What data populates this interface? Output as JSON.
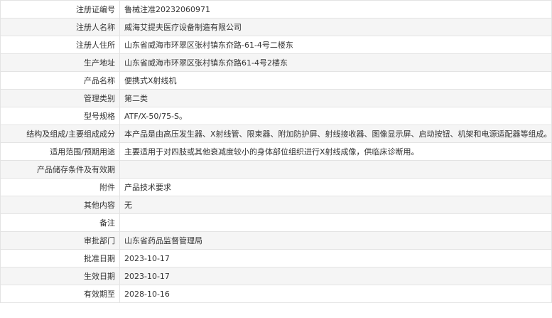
{
  "rows": [
    {
      "label": "注册证编号",
      "value": "鲁械注准20232060971"
    },
    {
      "label": "注册人名称",
      "value": "威海艾提夫医疗设备制造有限公司"
    },
    {
      "label": "注册人住所",
      "value": "山东省威海市环翠区张村镇东夼路-61-4号二楼东"
    },
    {
      "label": "生产地址",
      "value": "山东省威海市环翠区张村镇东夼路61-4号2楼东"
    },
    {
      "label": "产品名称",
      "value": "便携式X射线机"
    },
    {
      "label": "管理类别",
      "value": "第二类"
    },
    {
      "label": "型号规格",
      "value": "ATF/X-50/75-S。"
    },
    {
      "label": "结构及组成/主要组成成分",
      "value": "本产品是由高压发生器、X射线管、限束器、附加防护屏、射线接收器、图像显示屏、启动按钮、机架和电源适配器等组成。"
    },
    {
      "label": "适用范围/预期用途",
      "value": "主要适用于对四肢或其他衰减度较小的身体部位组织进行X射线成像，供临床诊断用。"
    },
    {
      "label": "产品储存条件及有效期",
      "value": ""
    },
    {
      "label": "附件",
      "value": "产品技术要求"
    },
    {
      "label": "其他内容",
      "value": "无"
    },
    {
      "label": "备注",
      "value": ""
    },
    {
      "label": "审批部门",
      "value": "山东省药品监督管理局"
    },
    {
      "label": "批准日期",
      "value": "2023-10-17"
    },
    {
      "label": "生效日期",
      "value": "2023-10-17"
    },
    {
      "label": "有效期至",
      "value": "2028-10-16"
    }
  ]
}
